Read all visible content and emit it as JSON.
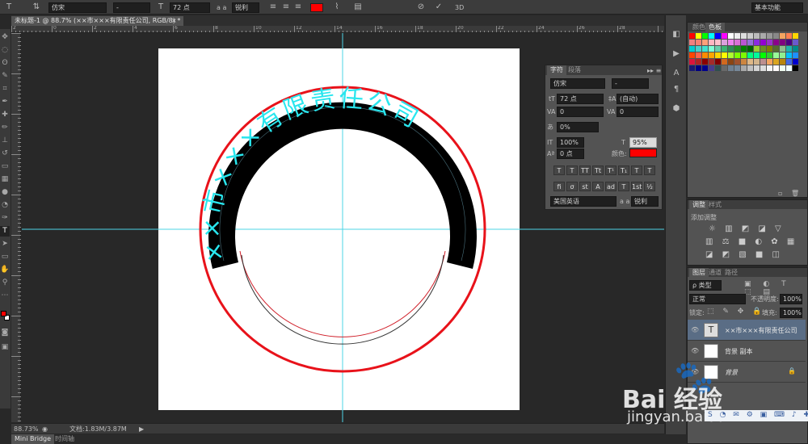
{
  "options_bar": {
    "font_family": "仿宋",
    "font_style": "-",
    "font_size": "72 点",
    "aa_label": "a a",
    "aa_mode": "锐利",
    "text_color": "#ff0000",
    "three_d": "3D",
    "workspace": "基本功能"
  },
  "document": {
    "tab_title": "未标题-1 @ 88.7% (××市×××有限责任公司, RGB/8) *",
    "zoom": "88.73%",
    "doc_info": "文档:1.83M/3.87M",
    "arc_text": "××市×××有限责任公司",
    "ruler_ticks": [
      "2",
      "0",
      "2",
      "4",
      "6",
      "8",
      "10",
      "12",
      "14",
      "16",
      "18",
      "20",
      "22",
      "24",
      "26",
      "28"
    ]
  },
  "character_panel": {
    "tab_char": "字符",
    "tab_para": "段落",
    "font_family": "仿宋",
    "font_style": "-",
    "size": "72 点",
    "leading": "(自动)",
    "kerning": "0",
    "tracking": "0",
    "scale_v_pct": "0%",
    "scale_h": "100%",
    "scale_v": "95%",
    "baseline": "0 点",
    "color_label": "颜色:",
    "color": "#ff0000",
    "style_buttons": [
      "T",
      "T",
      "TT",
      "Tt",
      "T¹",
      "T₁",
      "T",
      "T"
    ],
    "opentype_buttons": [
      "fi",
      "σ",
      "st",
      "A",
      "ad",
      "T",
      "1st",
      "½"
    ],
    "language": "美国英语",
    "aa_label": "a a",
    "aa_mode": "锐利"
  },
  "swatch_panel": {
    "tab_color": "颜色",
    "tab_swatches": "色板"
  },
  "adjustments_panel": {
    "tab_adjust": "调整",
    "tab_styles": "样式",
    "add_label": "添加调整"
  },
  "layers_panel": {
    "tabs": [
      "图层",
      "通道",
      "路径"
    ],
    "kind": "ρ 类型",
    "blend_mode": "正常",
    "opacity_label": "不透明度:",
    "opacity": "100%",
    "lock_label": "锁定:",
    "fill_label": "填充:",
    "fill": "100%",
    "layers": [
      {
        "name": "××市×××有限责任公司",
        "thumb": "T"
      },
      {
        "name": "背景 副本",
        "thumb": ""
      },
      {
        "name": "背景",
        "thumb": ""
      }
    ]
  },
  "bottom": {
    "mini_bridge": "Mini Bridge",
    "timeline": "时间轴"
  },
  "watermark": {
    "brand": "Bai 经验",
    "url": "jingyan.baidu"
  }
}
